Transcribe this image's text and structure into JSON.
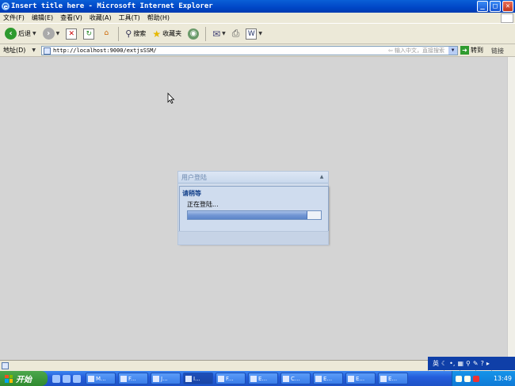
{
  "window": {
    "title": "Insert title here - Microsoft Internet Explorer",
    "minimize": "_",
    "maximize": "□",
    "close": "✕"
  },
  "menu": [
    "文件(F)",
    "编辑(E)",
    "查看(V)",
    "收藏(A)",
    "工具(T)",
    "帮助(H)"
  ],
  "toolbar": {
    "back": "后退",
    "search": "搜索",
    "favorites": "收藏夹"
  },
  "address": {
    "label": "地址(D)",
    "url": "http://localhost:9000/extjsSSM/",
    "search_hint": "输入中文，直接搜索",
    "go": "转到",
    "links": "链接"
  },
  "dialog": {
    "panel_title": "用户登陆",
    "msg_title": "请稍等",
    "msg_text": "正在登陆...",
    "progress": 0.9
  },
  "tray": {
    "ime": "英",
    "clock": "13:49"
  },
  "taskbar": {
    "start": "开始",
    "tasks": [
      {
        "label": "M...",
        "active": false
      },
      {
        "label": "F...",
        "active": false
      },
      {
        "label": "J...",
        "active": false
      },
      {
        "label": "I...",
        "active": true
      },
      {
        "label": "F...",
        "active": false
      },
      {
        "label": "E...",
        "active": false
      },
      {
        "label": "C...",
        "active": false
      },
      {
        "label": "E...",
        "active": false
      },
      {
        "label": "E...",
        "active": false
      },
      {
        "label": "E...",
        "active": false
      }
    ]
  },
  "colors": {
    "title_bar": "#0046c6",
    "content_bg": "#d4d4d4",
    "dialog_header_text": "#6a86ad",
    "msg_title": "#15428b"
  }
}
